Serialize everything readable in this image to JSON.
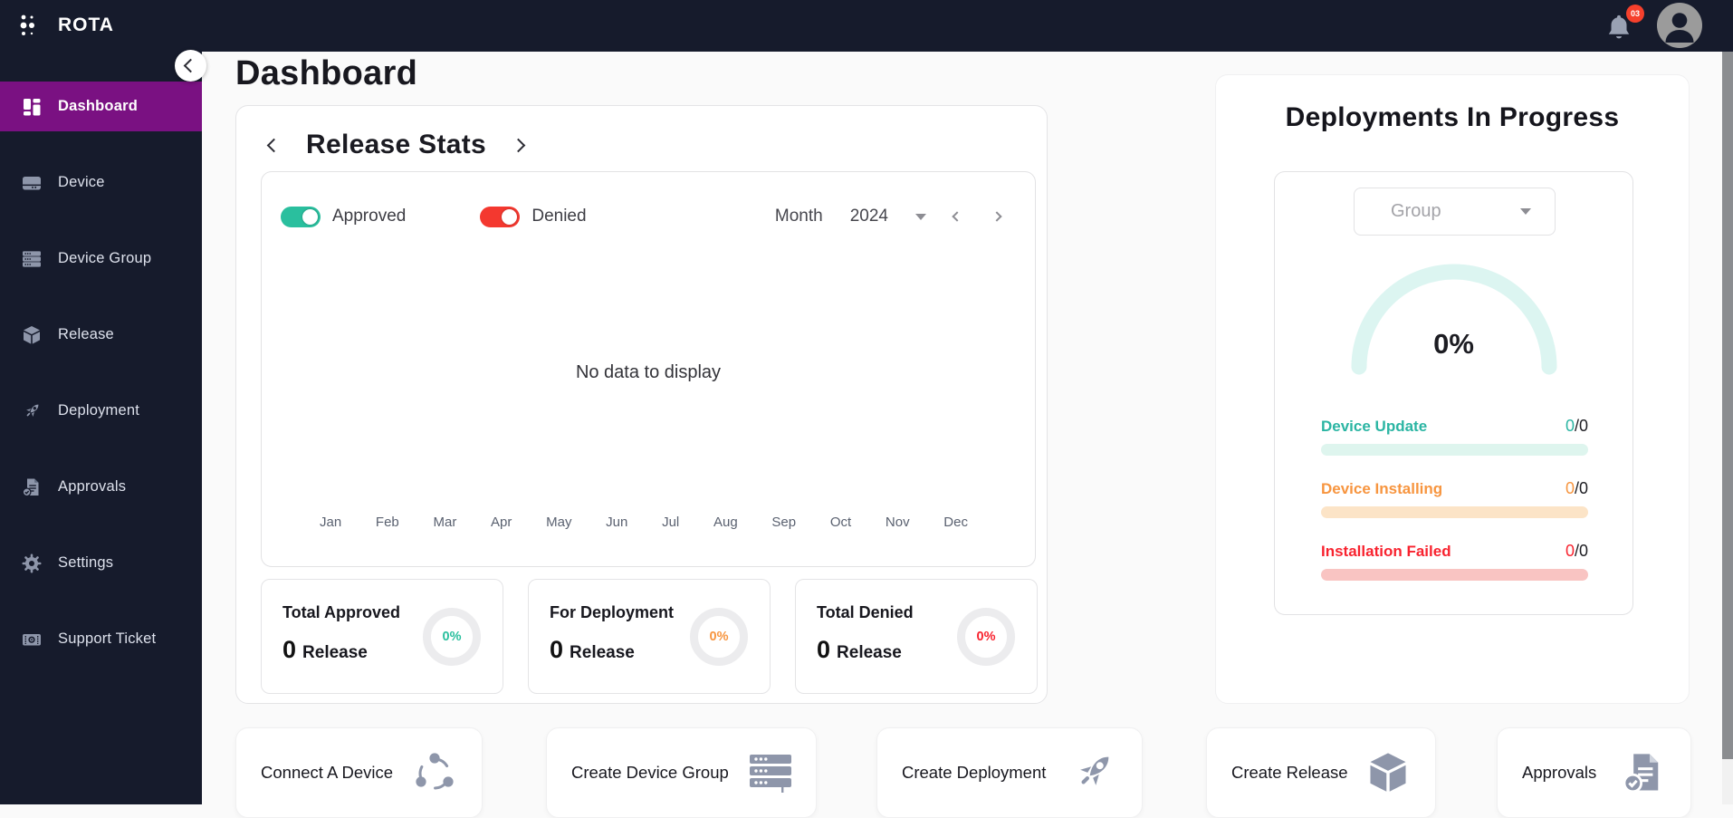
{
  "app": {
    "name": "ROTA"
  },
  "topbar": {
    "notification_count": "03"
  },
  "sidebar": {
    "items": [
      {
        "label": "Dashboard",
        "icon": "dashboard-grid-icon",
        "active": true
      },
      {
        "label": "Device",
        "icon": "device-icon",
        "active": false
      },
      {
        "label": "Device Group",
        "icon": "server-stack-icon",
        "active": false
      },
      {
        "label": "Release",
        "icon": "cube-icon",
        "active": false
      },
      {
        "label": "Deployment",
        "icon": "rocket-icon",
        "active": false
      },
      {
        "label": "Approvals",
        "icon": "document-check-icon",
        "active": false
      },
      {
        "label": "Settings",
        "icon": "gear-icon",
        "active": false
      },
      {
        "label": "Support Ticket",
        "icon": "ticket-icon",
        "active": false
      }
    ]
  },
  "page": {
    "title": "Dashboard"
  },
  "release_stats": {
    "title": "Release Stats",
    "toggle_approved": "Approved",
    "toggle_denied": "Denied",
    "period_label": "Month",
    "period_year": "2024",
    "empty_message": "No data to display",
    "months": [
      "Jan",
      "Feb",
      "Mar",
      "Apr",
      "May",
      "Jun",
      "Jul",
      "Aug",
      "Sep",
      "Oct",
      "Nov",
      "Dec"
    ],
    "summary": [
      {
        "title": "Total Approved",
        "count": "0",
        "unit": "Release",
        "percent": "0%"
      },
      {
        "title": "For Deployment",
        "count": "0",
        "unit": "Release",
        "percent": "0%"
      },
      {
        "title": "Total Denied",
        "count": "0",
        "unit": "Release",
        "percent": "0%"
      }
    ]
  },
  "deployments": {
    "title": "Deployments In Progress",
    "group_placeholder": "Group",
    "gauge_percent": "0%",
    "rows": [
      {
        "label": "Device Update",
        "value": "0",
        "of": "/0"
      },
      {
        "label": "Device Installing",
        "value": "0",
        "of": "/0"
      },
      {
        "label": "Installation Failed",
        "value": "0",
        "of": "/0"
      }
    ]
  },
  "quick_actions": [
    {
      "label": "Connect A Device",
      "icon": "connect-device-icon"
    },
    {
      "label": "Create Device Group",
      "icon": "server-stack-icon"
    },
    {
      "label": "Create Deployment",
      "icon": "rocket-icon"
    },
    {
      "label": "Create Release",
      "icon": "cube-icon"
    },
    {
      "label": "Approvals",
      "icon": "document-check-icon"
    }
  ],
  "colors": {
    "navy": "#161b2c",
    "purple_active": "#7a1182",
    "teal": "#2abf9e",
    "red": "#f4382f",
    "orange": "#f7953f",
    "mint_arc": "#dcf5f1",
    "bar_teal": "#def5ee",
    "bar_orange": "#fce4c7",
    "bar_red": "#f9c4c2",
    "icon_gray": "#8e96aa",
    "badge_red": "#f5402c"
  }
}
